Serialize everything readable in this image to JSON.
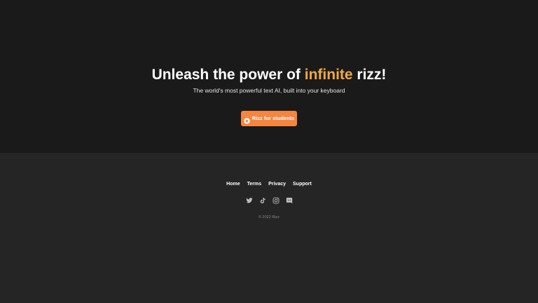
{
  "hero": {
    "headline_before": "Unleash the power of ",
    "headline_accent": "infinite",
    "headline_after": " rizz!",
    "subtitle": "The world's most powerful text AI, built into your keyboard",
    "cta_label": "Rizz for students",
    "cta_icon": "graduation-icon"
  },
  "footer": {
    "nav": [
      {
        "label": "Home"
      },
      {
        "label": "Terms"
      },
      {
        "label": "Privacy"
      },
      {
        "label": "Support"
      }
    ],
    "socials": [
      "twitter-icon",
      "tiktok-icon",
      "instagram-icon",
      "discord-icon"
    ],
    "copyright": "© 2022 Rizz"
  },
  "colors": {
    "hero_bg": "#1a1a1a",
    "footer_bg": "#252525",
    "accent": "#f3a93f",
    "cta_bg": "#f5853f"
  }
}
